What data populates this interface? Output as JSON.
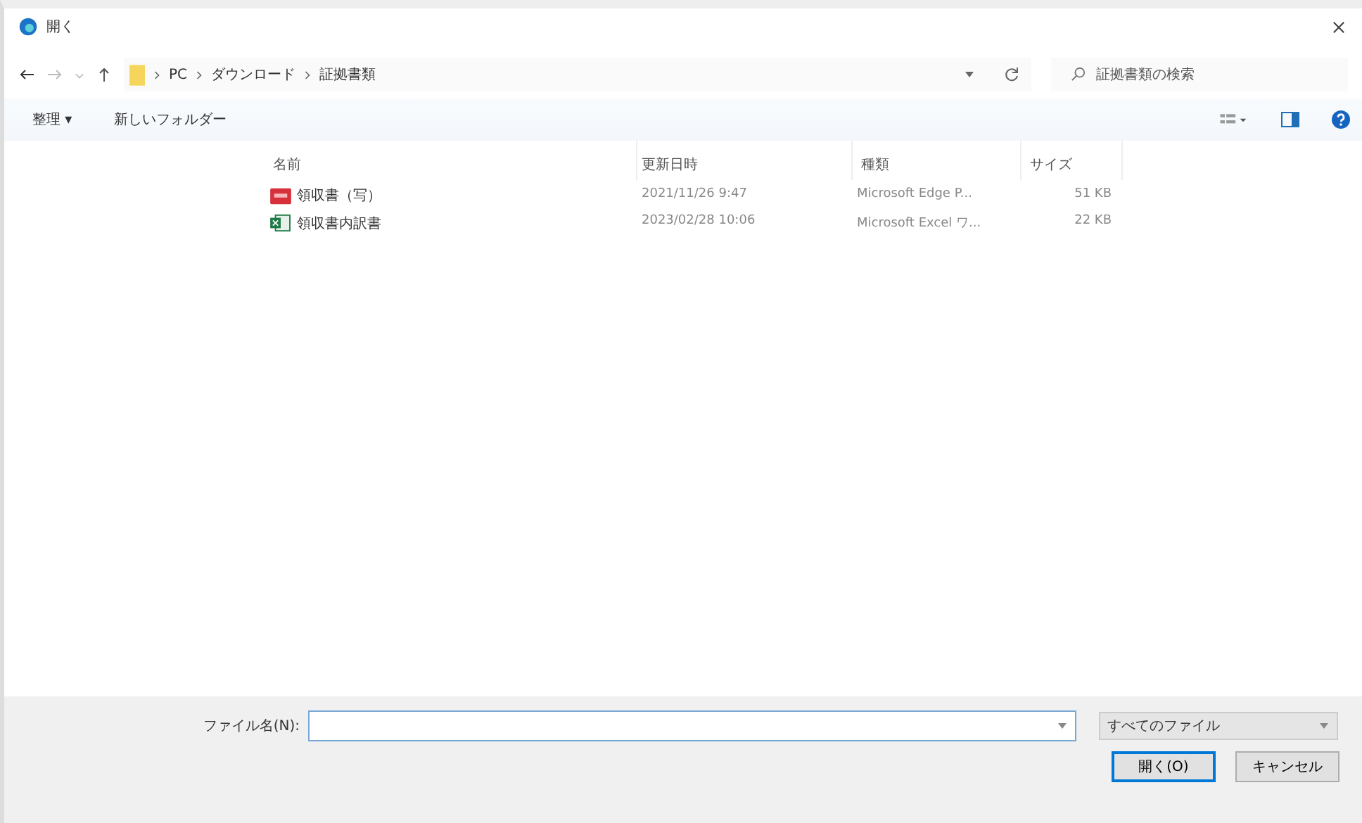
{
  "window": {
    "title": "開く"
  },
  "address_bar": {
    "path": [
      "PC",
      "ダウンロード",
      "証拠書類"
    ]
  },
  "search": {
    "placeholder": "証拠書類の検索"
  },
  "toolbar": {
    "organize": "整理 ▾",
    "new_folder": "新しいフォルダー"
  },
  "table": {
    "columns": [
      "名前",
      "更新日時",
      "種類",
      "サイズ"
    ],
    "rows": [
      {
        "kind": "pdf",
        "name": "領収書（写）",
        "modified": "2021/11/26 9:47",
        "type": "Microsoft Edge P...",
        "size": "51 KB"
      },
      {
        "kind": "excel",
        "name": "領収書内訳書",
        "modified": "2023/02/28 10:06",
        "type": "Microsoft Excel ワ...",
        "size": "22 KB"
      }
    ]
  },
  "footer": {
    "filename_label": "ファイル名(N):",
    "filter": "すべてのファイル",
    "open_button": "開く(O)",
    "cancel_button": "キャンセル"
  }
}
